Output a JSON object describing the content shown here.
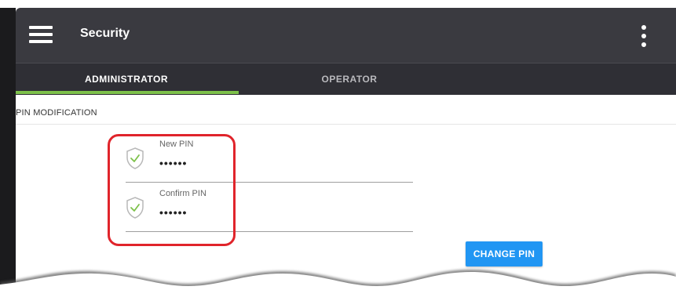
{
  "header": {
    "title": "Security",
    "menu_icon": "hamburger-menu-icon",
    "overflow_icon": "vertical-dots-icon"
  },
  "tabs": [
    {
      "label": "ADMINISTRATOR",
      "active": true
    },
    {
      "label": "OPERATOR",
      "active": false
    }
  ],
  "section": {
    "title": "PIN MODIFICATION"
  },
  "fields": {
    "new_pin": {
      "label": "New PIN",
      "value": "••••••",
      "icon": "shield-check-icon"
    },
    "confirm_pin": {
      "label": "Confirm PIN",
      "value": "••••••",
      "icon": "shield-check-icon"
    }
  },
  "actions": {
    "change_pin_label": "CHANGE PIN"
  },
  "colors": {
    "topbar": "#3a3a40",
    "tabbar": "#2f2f35",
    "tab_indicator": "#7dc14a",
    "primary_button": "#2196f3",
    "highlight": "#e0242b",
    "shield_check": "#7dc14a"
  }
}
